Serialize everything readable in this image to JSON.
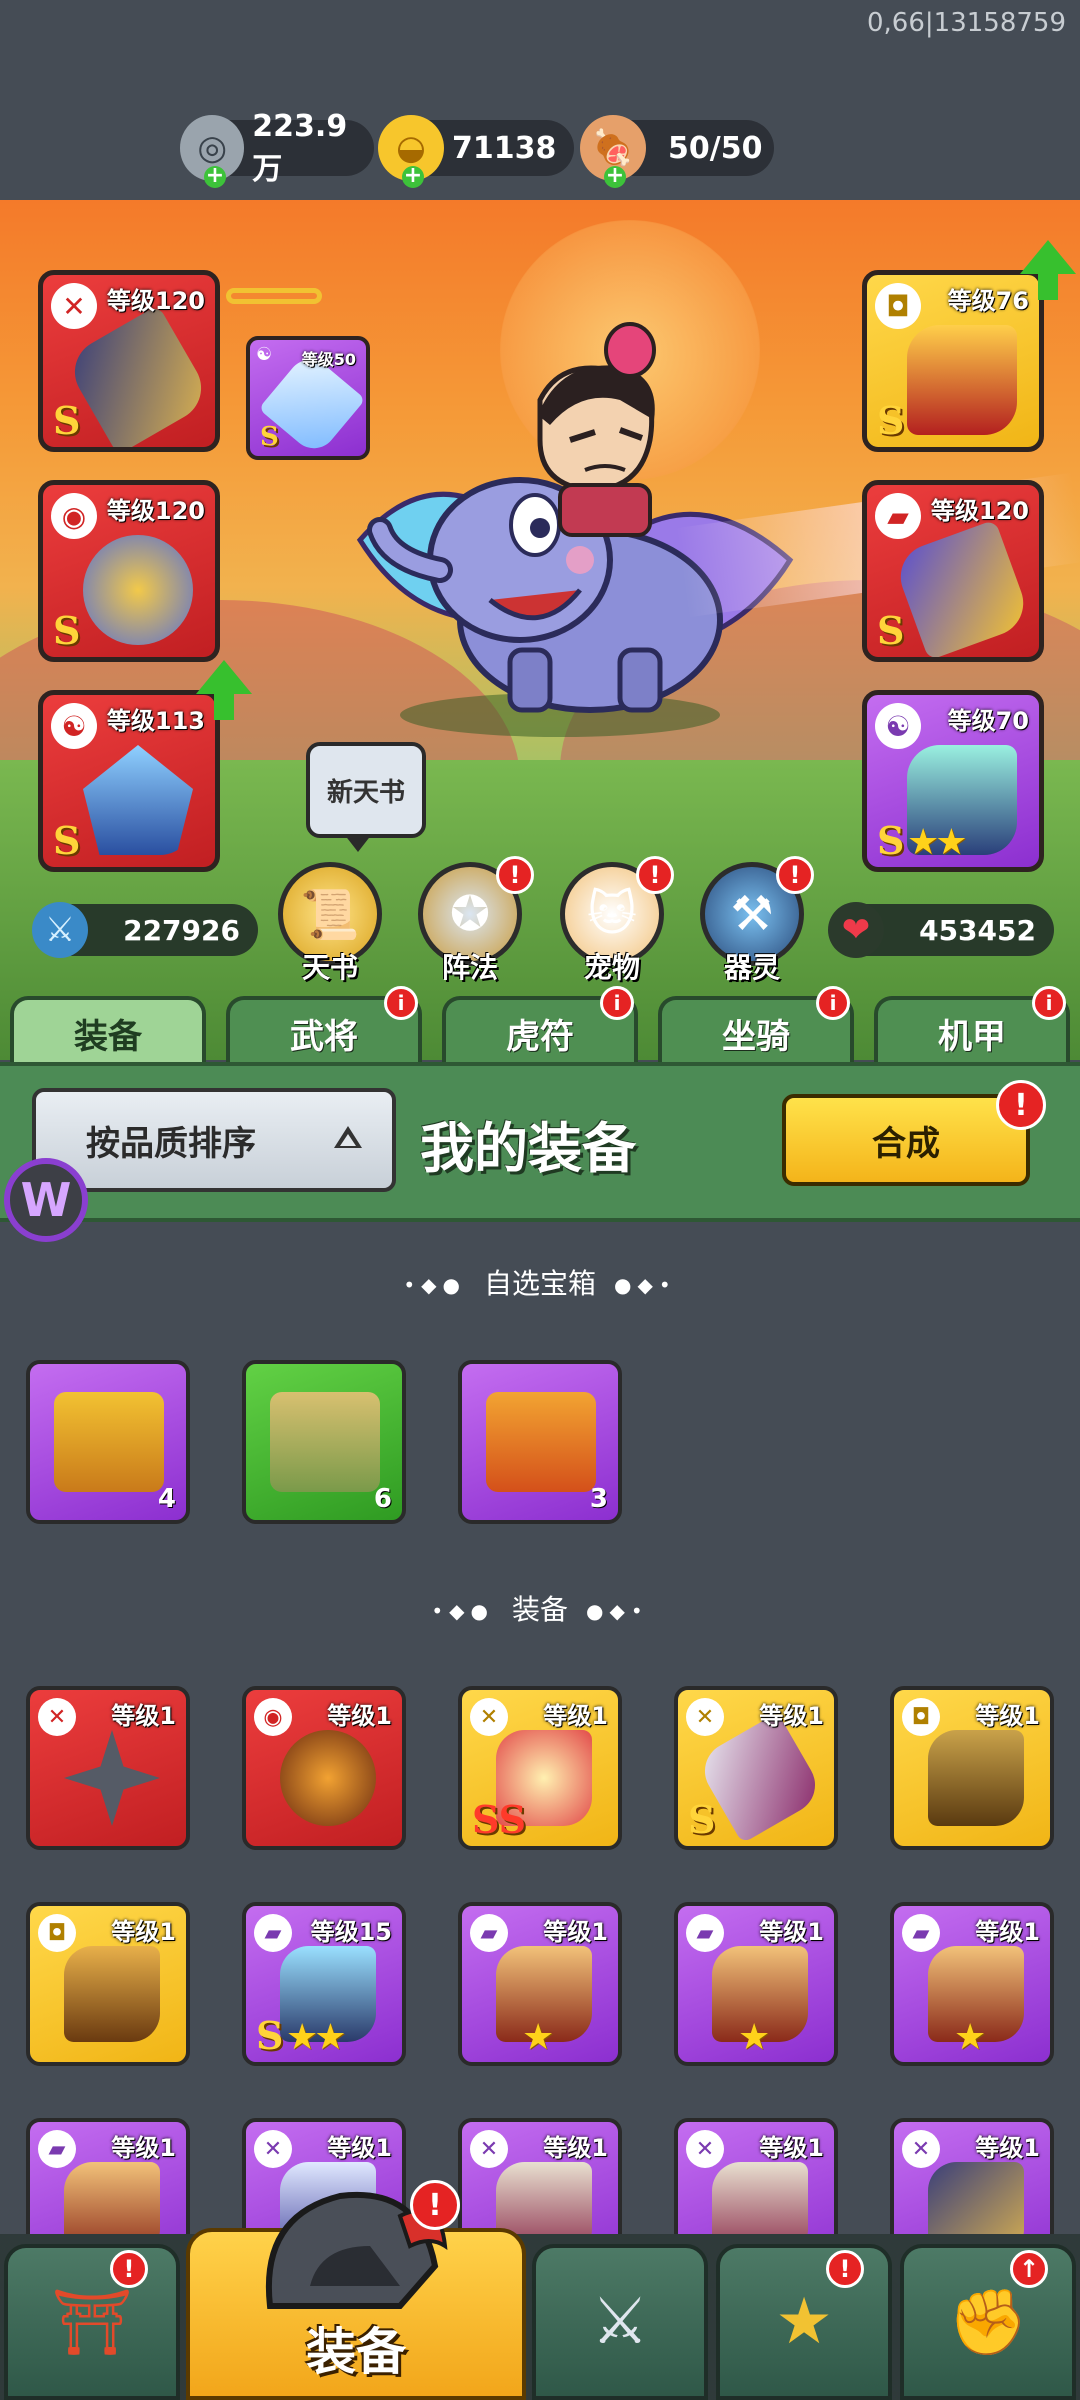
{
  "debug_text": "0,66|13158759",
  "resources": {
    "silver": "223.9万",
    "gold": "71138",
    "stamina": "50/50"
  },
  "hero": {
    "left_slots": [
      {
        "level": "等级120",
        "grade": "S",
        "color": "red"
      },
      {
        "level": "等级120",
        "grade": "S",
        "color": "red"
      },
      {
        "level": "等级113",
        "grade": "S",
        "color": "red"
      }
    ],
    "amulet": {
      "level": "等级50",
      "grade": "S"
    },
    "right_slots": [
      {
        "level": "等级76",
        "grade": "S",
        "color": "yellow"
      },
      {
        "level": "等级120",
        "grade": "S",
        "color": "red"
      },
      {
        "level": "等级70",
        "grade": "S",
        "color": "purple"
      }
    ],
    "tooltip": "新天书",
    "attack": "227926",
    "hp": "453452",
    "feature_buttons": [
      "天书",
      "阵法",
      "宠物",
      "器灵"
    ]
  },
  "tabs": [
    "装备",
    "武将",
    "虎符",
    "坐骑",
    "机甲"
  ],
  "panel": {
    "sort_label": "按品质排序",
    "title": "我的装备",
    "synth_label": "合成"
  },
  "sections": {
    "chests_title": "自选宝箱",
    "equip_title": "装备"
  },
  "chests": [
    {
      "count": "4",
      "color": "purple"
    },
    {
      "count": "6",
      "color": "green"
    },
    {
      "count": "3",
      "color": "purple"
    }
  ],
  "equipment_rows": [
    [
      {
        "level": "等级1",
        "color": "red"
      },
      {
        "level": "等级1",
        "color": "red"
      },
      {
        "level": "等级1",
        "color": "yellow",
        "grade": "SS"
      },
      {
        "level": "等级1",
        "color": "yellow",
        "grade": "S"
      },
      {
        "level": "等级1",
        "color": "yellow"
      }
    ],
    [
      {
        "level": "等级1",
        "color": "yellow"
      },
      {
        "level": "等级15",
        "color": "purple",
        "grade": "S",
        "stars": "★★"
      },
      {
        "level": "等级1",
        "color": "purple",
        "stars": "★"
      },
      {
        "level": "等级1",
        "color": "purple",
        "stars": "★"
      },
      {
        "level": "等级1",
        "color": "purple",
        "stars": "★"
      }
    ],
    [
      {
        "level": "等级1",
        "color": "purple"
      },
      {
        "level": "等级1",
        "color": "purple"
      },
      {
        "level": "等级1",
        "color": "purple"
      },
      {
        "level": "等级1",
        "color": "purple"
      },
      {
        "level": "等级1",
        "color": "purple"
      }
    ]
  ],
  "bottom_nav": {
    "active_label": "装备"
  }
}
